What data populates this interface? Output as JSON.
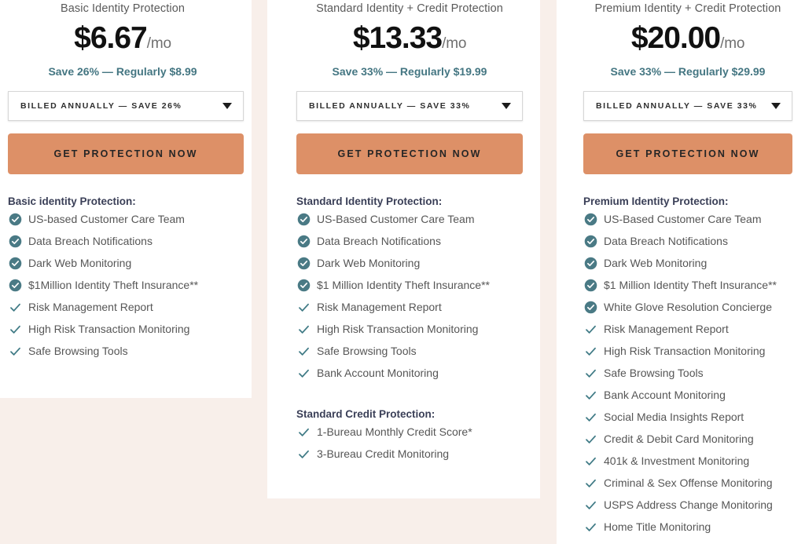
{
  "theme": {
    "page_background": "#f8efea",
    "card_background": "#ffffff",
    "cta_color": "#dd9067",
    "accent_teal": "#447682",
    "heading_color": "#3a3f57",
    "price_color": "#111111"
  },
  "plans": [
    {
      "name": "Basic Identity Protection",
      "price_amount": "$6.67",
      "price_period": "/mo",
      "save_note": "Save 26% — Regularly $8.99",
      "billing_option": "BILLED ANNUALLY — SAVE 26%",
      "cta_label": "GET PROTECTION NOW",
      "groups": [
        {
          "title": "Basic identity Protection:",
          "features": [
            {
              "label": "US-based Customer Care Team",
              "icon": "check-circle-filled-icon"
            },
            {
              "label": "Data Breach Notifications",
              "icon": "check-circle-filled-icon"
            },
            {
              "label": "Dark Web Monitoring",
              "icon": "check-circle-filled-icon"
            },
            {
              "label": "$1Million Identity Theft Insurance**",
              "icon": "check-circle-filled-icon"
            },
            {
              "label": "Risk Management Report",
              "icon": "check-icon"
            },
            {
              "label": "High Risk Transaction Monitoring",
              "icon": "check-icon"
            },
            {
              "label": "Safe Browsing Tools",
              "icon": "check-icon"
            }
          ]
        }
      ]
    },
    {
      "name": "Standard Identity + Credit Protection",
      "price_amount": "$13.33",
      "price_period": "/mo",
      "save_note": "Save 33% — Regularly $19.99",
      "billing_option": "BILLED ANNUALLY — SAVE 33%",
      "cta_label": "GET PROTECTION NOW",
      "groups": [
        {
          "title": "Standard Identity Protection:",
          "features": [
            {
              "label": "US-Based Customer Care Team",
              "icon": "check-circle-filled-icon"
            },
            {
              "label": "Data Breach Notifications",
              "icon": "check-circle-filled-icon"
            },
            {
              "label": "Dark Web Monitoring",
              "icon": "check-circle-filled-icon"
            },
            {
              "label": "$1 Million Identity Theft Insurance**",
              "icon": "check-circle-filled-icon"
            },
            {
              "label": "Risk Management Report",
              "icon": "check-icon"
            },
            {
              "label": "High Risk Transaction Monitoring",
              "icon": "check-icon"
            },
            {
              "label": "Safe Browsing Tools",
              "icon": "check-icon"
            },
            {
              "label": "Bank Account Monitoring",
              "icon": "check-icon"
            }
          ]
        },
        {
          "title": "Standard Credit Protection:",
          "features": [
            {
              "label": "1-Bureau Monthly Credit Score*",
              "icon": "check-icon"
            },
            {
              "label": "3-Bureau Credit Monitoring",
              "icon": "check-icon"
            }
          ]
        }
      ]
    },
    {
      "name": "Premium Identity + Credit Protection",
      "price_amount": "$20.00",
      "price_period": "/mo",
      "save_note": "Save 33% — Regularly $29.99",
      "billing_option": "BILLED ANNUALLY — SAVE 33%",
      "cta_label": "GET PROTECTION NOW",
      "groups": [
        {
          "title": "Premium Identity Protection:",
          "features": [
            {
              "label": "US-Based Customer Care Team",
              "icon": "check-circle-filled-icon"
            },
            {
              "label": "Data Breach Notifications",
              "icon": "check-circle-filled-icon"
            },
            {
              "label": "Dark Web Monitoring",
              "icon": "check-circle-filled-icon"
            },
            {
              "label": "$1 Million Identity Theft Insurance**",
              "icon": "check-circle-filled-icon"
            },
            {
              "label": "White Glove Resolution Concierge",
              "icon": "check-circle-filled-icon"
            },
            {
              "label": "Risk Management Report",
              "icon": "check-icon"
            },
            {
              "label": "High Risk Transaction Monitoring",
              "icon": "check-icon"
            },
            {
              "label": "Safe Browsing Tools",
              "icon": "check-icon"
            },
            {
              "label": "Bank Account Monitoring",
              "icon": "check-icon"
            },
            {
              "label": "Social Media Insights Report",
              "icon": "check-icon"
            },
            {
              "label": "Credit & Debit Card Monitoring",
              "icon": "check-icon"
            },
            {
              "label": "401k & Investment Monitoring",
              "icon": "check-icon"
            },
            {
              "label": "Criminal & Sex Offense Monitoring",
              "icon": "check-icon"
            },
            {
              "label": "USPS Address Change Monitoring",
              "icon": "check-icon"
            },
            {
              "label": "Home Title Monitoring",
              "icon": "check-icon"
            }
          ]
        }
      ]
    }
  ]
}
